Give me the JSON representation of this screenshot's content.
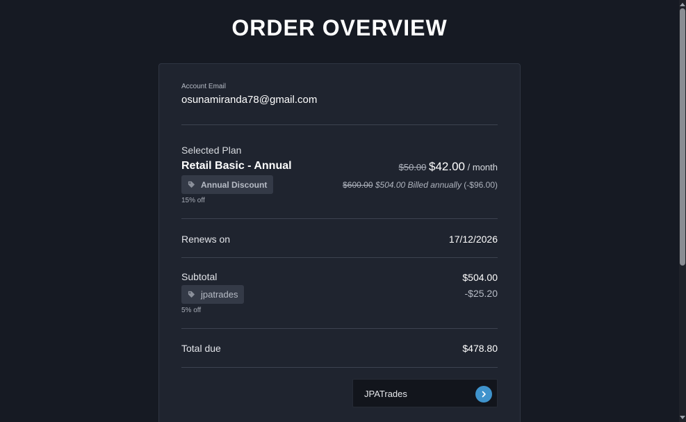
{
  "page": {
    "title": "ORDER OVERVIEW"
  },
  "account": {
    "label": "Account Email",
    "email": "osunamiranda78@gmail.com"
  },
  "plan": {
    "section_label": "Selected Plan",
    "name": "Retail Basic - Annual",
    "original_monthly": "$50.00",
    "monthly_price": "$42.00",
    "per_period": "/ month",
    "discount_tag": "Annual Discount",
    "discount_off": "15% off",
    "original_annual": "$600.00",
    "annual_billed": "$504.00 Billed annually",
    "annual_savings": "(-$96.00)"
  },
  "renewal": {
    "label": "Renews on",
    "date": "17/12/2026"
  },
  "subtotal": {
    "label": "Subtotal",
    "value": "$504.00",
    "coupon_tag": "jpatrades",
    "coupon_off": "5% off",
    "coupon_discount": "-$25.20"
  },
  "total": {
    "label": "Total due",
    "value": "$478.80"
  },
  "coupon_input": {
    "value": "JPATrades"
  },
  "colors": {
    "background": "#161a23",
    "card": "#1f242f",
    "accent": "#3f93cc",
    "tag_bg": "#343a47"
  },
  "icons": {
    "tag": "tag-icon",
    "submit": "chevron-right-icon"
  }
}
